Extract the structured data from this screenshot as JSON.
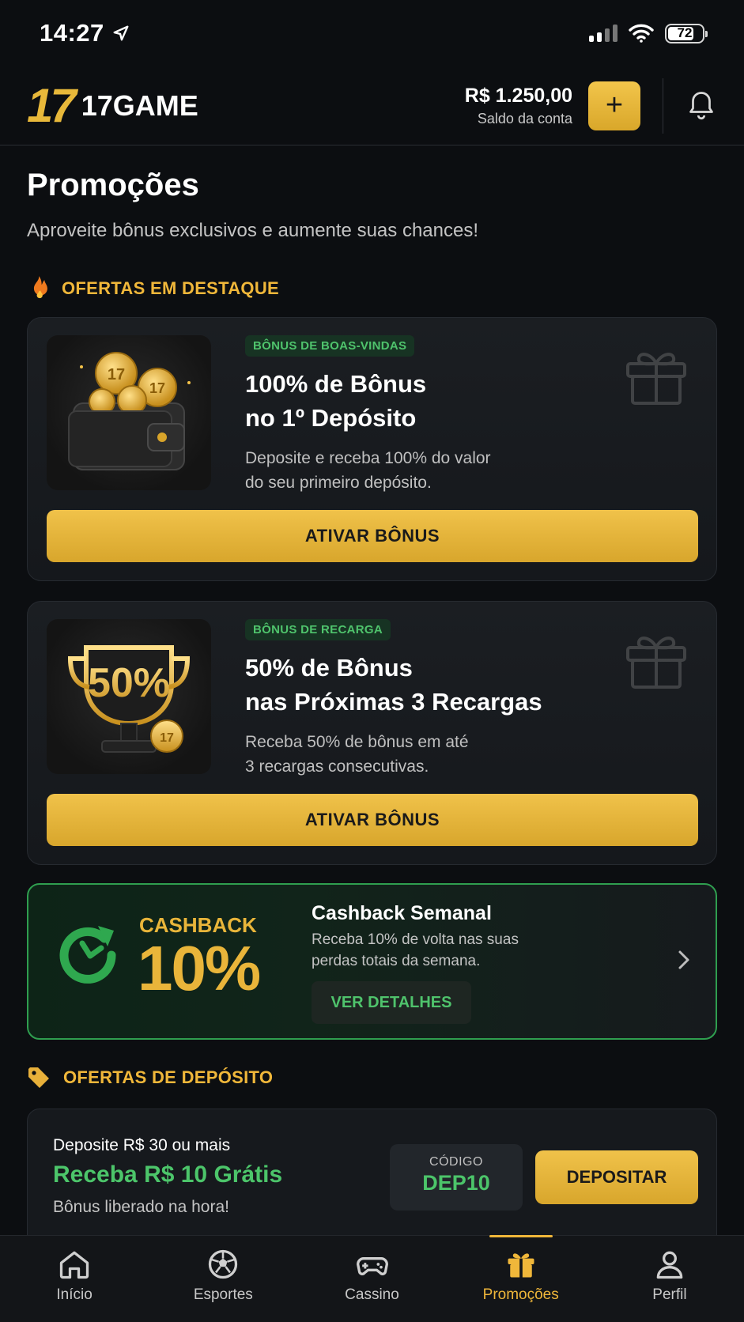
{
  "status_bar": {
    "time": "14:27",
    "battery": "72"
  },
  "header": {
    "logo_mark": "17",
    "logo_text": "17GAME",
    "balance_amount": "R$ 1.250,00",
    "balance_label": "Saldo da conta",
    "add_label": "+"
  },
  "page": {
    "title": "Promoções",
    "subtitle": "Aproveite bônus exclusivos e aumente suas chances!"
  },
  "featured": {
    "section_label": "OFERTAS EM DESTAQUE",
    "cards": [
      {
        "tag": "BÔNUS DE BOAS-VINDAS",
        "title": "100% de Bônus\nno 1º Depósito",
        "description": "Deposite e receba 100% do valor\ndo seu primeiro depósito.",
        "button": "ATIVAR BÔNUS"
      },
      {
        "tag": "BÔNUS DE RECARGA",
        "title": "50% de Bônus\nnas Próximas 3 Recargas",
        "description": "Receba 50% de bônus em até\n3 recargas consecutivas.",
        "button": "ATIVAR BÔNUS",
        "badge_text": "50%"
      }
    ]
  },
  "cashback": {
    "word": "CASHBACK",
    "percent": "10%",
    "title": "Cashback Semanal",
    "description": "Receba 10% de volta nas suas\nperdas totais da semana.",
    "button": "VER DETALHES"
  },
  "deposit": {
    "section_label": "OFERTAS DE DEPÓSITO",
    "condition": "Deposite R$ 30 ou mais",
    "reward": "Receba R$ 10 Grátis",
    "note": "Bônus liberado na hora!",
    "code_label": "CÓDIGO",
    "code_value": "DEP10",
    "button": "DEPOSITAR"
  },
  "tabbar": {
    "items": [
      {
        "label": "Início",
        "icon": "home-icon"
      },
      {
        "label": "Esportes",
        "icon": "soccer-ball-icon"
      },
      {
        "label": "Cassino",
        "icon": "gamepad-icon"
      },
      {
        "label": "Promoções",
        "icon": "gift-icon",
        "active": true
      },
      {
        "label": "Perfil",
        "icon": "user-icon"
      }
    ]
  },
  "colors": {
    "accent_gold": "#f0b73a",
    "accent_green": "#4cc56a",
    "background": "#0c0e11"
  }
}
